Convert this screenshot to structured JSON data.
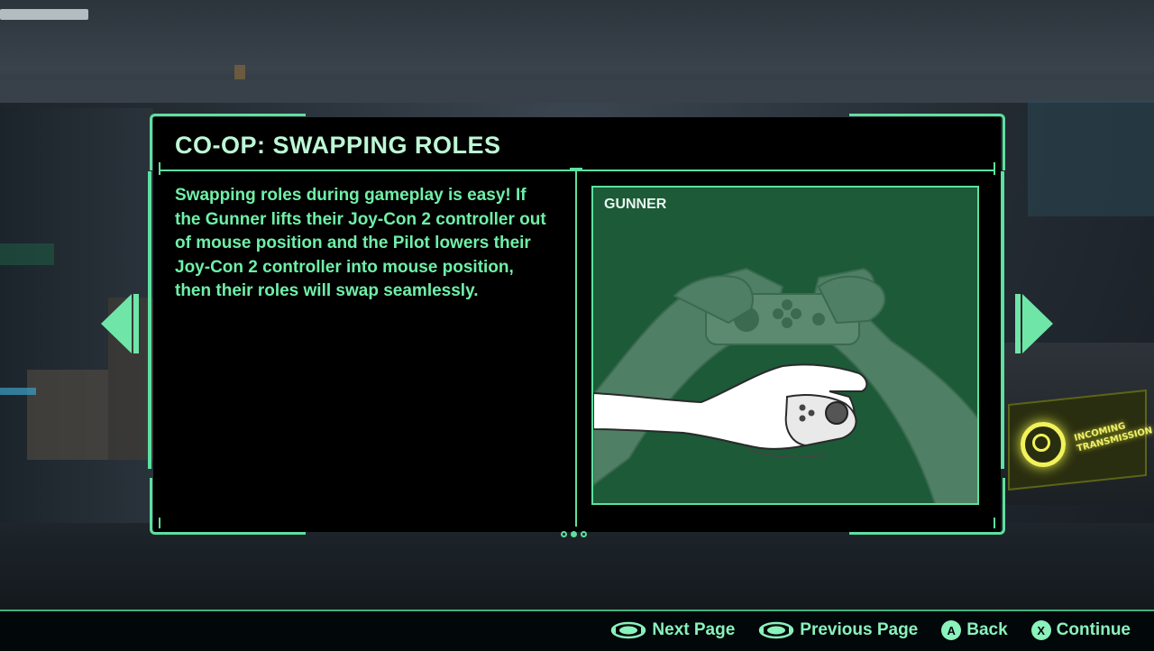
{
  "panel": {
    "title": "CO-OP: SWAPPING ROLES",
    "body": "Swapping roles during gameplay is easy! If the Gunner lifts their Joy-Con 2 controller out of mouse position and the Pilot lowers their Joy-Con 2 controller into mouse position, then their roles will swap seamlessly.",
    "illustration_label": "GUNNER",
    "page_dots": {
      "count": 3,
      "active_index": 1
    }
  },
  "background": {
    "incoming_line1": "INCOMING",
    "incoming_line2": "TRANSMISSION"
  },
  "hints": [
    {
      "icon": "stick-icon",
      "label": "Next Page"
    },
    {
      "icon": "stick-icon",
      "label": "Previous Page"
    },
    {
      "icon": "a-button-icon",
      "glyph": "A",
      "label": "Back"
    },
    {
      "icon": "x-button-icon",
      "glyph": "X",
      "label": "Continue"
    }
  ],
  "colors": {
    "accent": "#5de0a0",
    "title": "#bdf8d6",
    "body_text": "#6ff0a8",
    "illustration_bg": "#1c5a38"
  }
}
